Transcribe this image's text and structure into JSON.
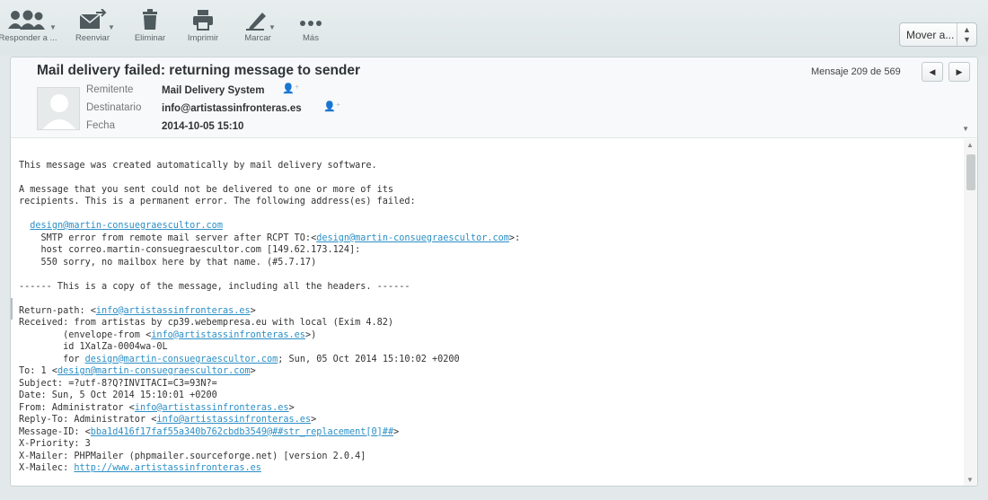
{
  "toolbar": {
    "reply_label": "Responder a ...",
    "forward_label": "Reenviar",
    "delete_label": "Eliminar",
    "print_label": "Imprimir",
    "mark_label": "Marcar",
    "more_label": "Más",
    "move_label": "Mover a..."
  },
  "message": {
    "subject": "Mail delivery failed: returning message to sender",
    "counter": "Mensaje 209 de 569",
    "from_label": "Remitente",
    "from_value": "Mail Delivery System",
    "to_label": "Destinatario",
    "to_value": "info@artistassinfronteras.es",
    "date_label": "Fecha",
    "date_value": "2014-10-05 15:10"
  },
  "body": {
    "l1": "This message was created automatically by mail delivery software.",
    "l2": "A message that you sent could not be delivered to one or more of its",
    "l3": "recipients. This is a permanent error. The following address(es) failed:",
    "failed_addr": "design@martin-consuegraescultor.com",
    "smtp_prefix": "    SMTP error from remote mail server after RCPT TO:<",
    "smtp_link": "design@martin-consuegraescultor.com",
    "smtp_suffix": ">:",
    "host_line": "    host correo.martin-consuegraescultor.com [149.62.173.124]:",
    "sorry_line": "    550 sorry, no mailbox here by that name. (#5.7.17)",
    "copy_line": "------ This is a copy of the message, including all the headers. ------",
    "rp_prefix": "Return-path: <",
    "rp_link": "info@artistassinfronteras.es",
    "rp_suffix": ">",
    "recv_line": "Received: from artistas by cp39.webempresa.eu with local (Exim 4.82)",
    "env_prefix": "        (envelope-from <",
    "env_link": "info@artistassinfronteras.es",
    "env_suffix": ">)",
    "id_line": "        id 1XalZa-0004wa-0L",
    "for_prefix": "        for ",
    "for_link": "design@martin-consuegraescultor.com",
    "for_suffix": "; Sun, 05 Oct 2014 15:10:02 +0200",
    "to_prefix": "To: 1 <",
    "to_link": "design@martin-consuegraescultor.com",
    "to_suffix": ">",
    "subject_line": "Subject: =?utf-8?Q?INVITACI=C3=93N?=",
    "date_line": "Date: Sun, 5 Oct 2014 15:10:01 +0200",
    "from_prefix": "From: Administrator <",
    "from_link": "info@artistassinfronteras.es",
    "from_suffix": ">",
    "replyto_prefix": "Reply-To: Administrator <",
    "replyto_link": "info@artistassinfronteras.es",
    "replyto_suffix": ">",
    "msgid_prefix": "Message-ID: <",
    "msgid_link": "bba1d416f17faf55a340b762cbdb3549@##str_replacement[0]##",
    "msgid_suffix": ">",
    "prio_line": "X-Priority: 3",
    "mailer_line": "X-Mailer: PHPMailer (phpmailer.sourceforge.net) [version 2.0.4]",
    "mailec_prefix": "X-Mailec: ",
    "mailec_link": "http://www.artistassinfronteras.es"
  },
  "colors": {
    "link": "#2b8fc6",
    "background": "#e3e9ea"
  }
}
